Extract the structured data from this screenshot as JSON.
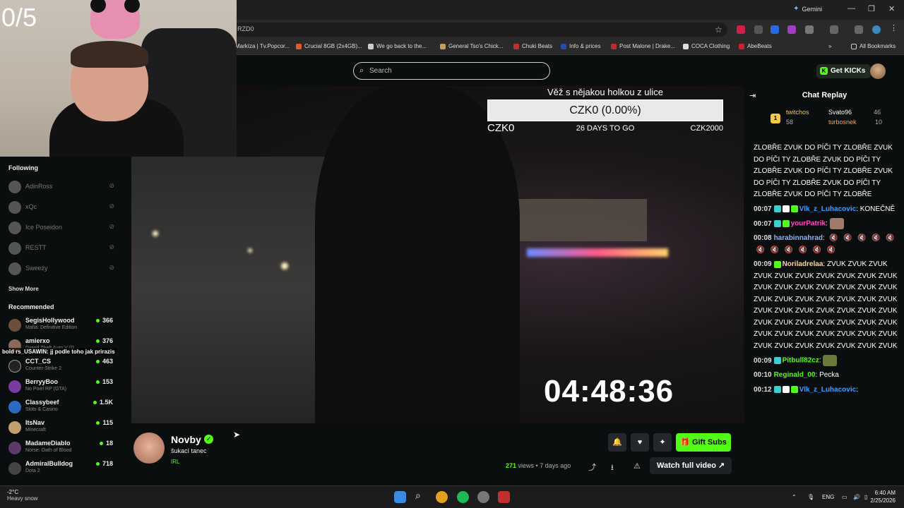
{
  "browser": {
    "gemini_label": "Gemini",
    "url_fragment": "RZD0",
    "bookmarks": [
      "Markíza | Tv.Popcor...",
      "Crucial 8GB (2x4GB)...",
      "We go back to the...",
      "General Tso's Chick...",
      "Chuki Beats",
      "Info & prices",
      "Post Malone | Drake...",
      "COCA Clothing",
      "AbeBeats"
    ],
    "all_bookmarks": "All Bookmarks"
  },
  "header": {
    "search_placeholder": "Search",
    "get_kicks": "Get KICKs"
  },
  "webcam": {
    "counter": "0/5"
  },
  "sidebar": {
    "following_title": "Following",
    "following": [
      "AdinRoss",
      "xQc",
      "Ice Poseidon",
      "RESTT",
      "Sweezy"
    ],
    "show_more": "Show More",
    "recommended_title": "Recommended",
    "recommended": [
      {
        "name": "SegisHollywood",
        "category": "Mafia: Definitive Edition",
        "viewers": "366",
        "color": "#6b4f3a"
      },
      {
        "name": "amierxo",
        "category": "Grand Theft Auto V (G",
        "viewers": "376",
        "color": "#8a6a5a"
      },
      {
        "name": "CCT_CS",
        "category": "Counter-Strike 2",
        "viewers": "463",
        "color": "#222"
      },
      {
        "name": "BerryyBoo",
        "category": "No Pixel RP (GTA)",
        "viewers": "153",
        "color": "#7a3aa0"
      },
      {
        "name": "Classybeef",
        "category": "Slots & Casino",
        "viewers": "1.5K",
        "color": "#2a6ac0"
      },
      {
        "name": "ItsNav",
        "category": "Minecraft",
        "viewers": "115",
        "color": "#c0a070"
      },
      {
        "name": "MadameDiablo",
        "category": "Norse: Oath of Blood",
        "viewers": "18",
        "color": "#5a3a6a"
      },
      {
        "name": "AdmiralBulldog",
        "category": "Dota 2",
        "viewers": "718",
        "color": "#444"
      }
    ],
    "overlay_chat": "bold rs_USAWIN: jj podle toho jak prirazis"
  },
  "video": {
    "goal_title": "Věž s nějakou holkou z ulice",
    "goal_progress": "CZK0 (0.00%)",
    "goal_fraction": 0.0,
    "goal_min": "CZK0",
    "goal_days": "26 DAYS TO GO",
    "goal_max": "CZK2000",
    "timer": "04:48:36"
  },
  "stream": {
    "name": "Novby",
    "title": "šukací tanec",
    "category": "IRL",
    "gift_subs": "Gift Subs",
    "views_count": "271",
    "views_suffix": " views • 7 days ago",
    "watch_full": "Watch full video"
  },
  "chat": {
    "title": "Chat Replay",
    "top_gifters": [
      {
        "name": "twitchos",
        "count": "58",
        "color": "#f6c744"
      },
      {
        "name": "Svato96",
        "count": "46",
        "color": "#ffffff"
      },
      {
        "name": "turbosnek",
        "count": "10",
        "color": "#f6a544"
      }
    ],
    "spam_text": "ZLOBŘE ZVUK DO PÍČI TY ZLOBŘE ZVUK DO PÍČI TY ZLOBŘE ZVUK DO PÍČI TY ZLOBŘE ZVUK DO PÍČI TY ZLOBŘE ZVUK DO PÍČI TY ZLOBŘE ZVUK DO PÍČI TY ZLOBŘE ZVUK DO PÍČI TY ZLOBŘE",
    "messages": [
      {
        "time": "00:07",
        "user": "Vlk_z_Luhacovic",
        "text": "KONEČNĚ",
        "color": "#3aa0ff"
      },
      {
        "time": "00:07",
        "user": "yourPatrik",
        "text": "",
        "color": "#ff4ac0"
      },
      {
        "time": "00:08",
        "user": "harabinnahrad",
        "text": "",
        "color": "#8ab4f8"
      },
      {
        "time": "00:09",
        "user": "Noriladrelaa",
        "text": "ZVUK ZVUK ZVUK ZVUK ZVUK ZVUK ZVUK ZVUK ZVUK ZVUK ZVUK ZVUK ZVUK ZVUK ZVUK ZVUK ZVUK ZVUK ZVUK ZVUK ZVUK ZVUK ZVUK ZVUK ZVUK ZVUK ZVUK ZVUK ZVUK ZVUK ZVUK ZVUK ZVUK ZVUK ZVUK ZVUK ZVUK ZVUK ZVUK ZVUK ZVUK ZVUK ZVUK ZVUK ZVUK ZVUK ZVUK ZVUK ZVUK ZVUK ZVUK ZVUK",
        "color": "#f6d6a0"
      },
      {
        "time": "00:09",
        "user": "Pitbull82cz",
        "text": "",
        "color": "#53fc18"
      },
      {
        "time": "00:10",
        "user": "Reginald_00",
        "text": "Pecka",
        "color": "#53fc18"
      },
      {
        "time": "00:12",
        "user": "Vlk_z_Luhacovic",
        "text": "",
        "color": "#3aa0ff"
      }
    ]
  },
  "taskbar": {
    "temp": "-2°C",
    "weather": "Heavy snow",
    "lang": "ENG",
    "time": "6:40 AM",
    "date": "2/25/2026"
  }
}
